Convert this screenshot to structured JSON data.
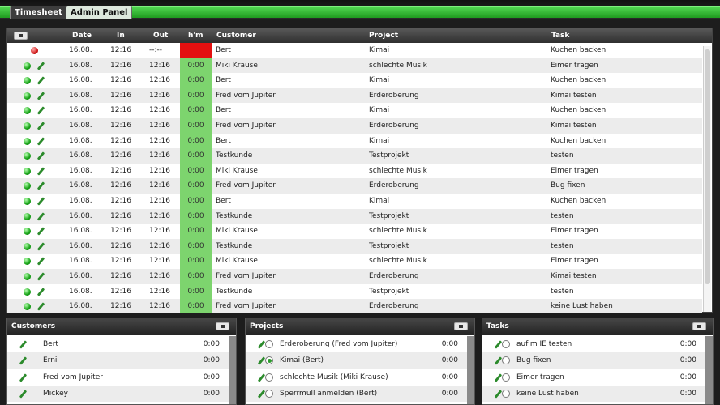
{
  "tabs": [
    {
      "label": "Timesheet",
      "active": true
    },
    {
      "label": "Admin Panel",
      "active": false
    }
  ],
  "timesheet": {
    "columns": {
      "date": "Date",
      "in": "In",
      "out": "Out",
      "hm": "h'm",
      "customer": "Customer",
      "project": "Project",
      "task": "Task"
    },
    "rows": [
      {
        "status": "red",
        "date": "16.08.",
        "in": "12:16",
        "out": "--:--",
        "hm": "",
        "customer": "Bert",
        "project": "Kimai",
        "task": "Kuchen backen"
      },
      {
        "status": "green",
        "date": "16.08.",
        "in": "12:16",
        "out": "12:16",
        "hm": "0:00",
        "customer": "Miki Krause",
        "project": "schlechte Musik",
        "task": "Eimer tragen"
      },
      {
        "status": "green",
        "date": "16.08.",
        "in": "12:16",
        "out": "12:16",
        "hm": "0:00",
        "customer": "Bert",
        "project": "Kimai",
        "task": "Kuchen backen"
      },
      {
        "status": "green",
        "date": "16.08.",
        "in": "12:16",
        "out": "12:16",
        "hm": "0:00",
        "customer": "Fred vom Jupiter",
        "project": "Erderoberung",
        "task": "Kimai testen"
      },
      {
        "status": "green",
        "date": "16.08.",
        "in": "12:16",
        "out": "12:16",
        "hm": "0:00",
        "customer": "Bert",
        "project": "Kimai",
        "task": "Kuchen backen"
      },
      {
        "status": "green",
        "date": "16.08.",
        "in": "12:16",
        "out": "12:16",
        "hm": "0:00",
        "customer": "Fred vom Jupiter",
        "project": "Erderoberung",
        "task": "Kimai testen"
      },
      {
        "status": "green",
        "date": "16.08.",
        "in": "12:16",
        "out": "12:16",
        "hm": "0:00",
        "customer": "Bert",
        "project": "Kimai",
        "task": "Kuchen backen"
      },
      {
        "status": "green",
        "date": "16.08.",
        "in": "12:16",
        "out": "12:16",
        "hm": "0:00",
        "customer": "Testkunde",
        "project": "Testprojekt",
        "task": "testen"
      },
      {
        "status": "green",
        "date": "16.08.",
        "in": "12:16",
        "out": "12:16",
        "hm": "0:00",
        "customer": "Miki Krause",
        "project": "schlechte Musik",
        "task": "Eimer tragen"
      },
      {
        "status": "green",
        "date": "16.08.",
        "in": "12:16",
        "out": "12:16",
        "hm": "0:00",
        "customer": "Fred vom Jupiter",
        "project": "Erderoberung",
        "task": "Bug fixen"
      },
      {
        "status": "green",
        "date": "16.08.",
        "in": "12:16",
        "out": "12:16",
        "hm": "0:00",
        "customer": "Bert",
        "project": "Kimai",
        "task": "Kuchen backen"
      },
      {
        "status": "green",
        "date": "16.08.",
        "in": "12:16",
        "out": "12:16",
        "hm": "0:00",
        "customer": "Testkunde",
        "project": "Testprojekt",
        "task": "testen"
      },
      {
        "status": "green",
        "date": "16.08.",
        "in": "12:16",
        "out": "12:16",
        "hm": "0:00",
        "customer": "Miki Krause",
        "project": "schlechte Musik",
        "task": "Eimer tragen"
      },
      {
        "status": "green",
        "date": "16.08.",
        "in": "12:16",
        "out": "12:16",
        "hm": "0:00",
        "customer": "Testkunde",
        "project": "Testprojekt",
        "task": "testen"
      },
      {
        "status": "green",
        "date": "16.08.",
        "in": "12:16",
        "out": "12:16",
        "hm": "0:00",
        "customer": "Miki Krause",
        "project": "schlechte Musik",
        "task": "Eimer tragen"
      },
      {
        "status": "green",
        "date": "16.08.",
        "in": "12:16",
        "out": "12:16",
        "hm": "0:00",
        "customer": "Fred vom Jupiter",
        "project": "Erderoberung",
        "task": "Kimai testen"
      },
      {
        "status": "green",
        "date": "16.08.",
        "in": "12:16",
        "out": "12:16",
        "hm": "0:00",
        "customer": "Testkunde",
        "project": "Testprojekt",
        "task": "testen"
      },
      {
        "status": "green",
        "date": "16.08.",
        "in": "12:16",
        "out": "12:16",
        "hm": "0:00",
        "customer": "Fred vom Jupiter",
        "project": "Erderoberung",
        "task": "keine Lust haben"
      }
    ]
  },
  "customers": {
    "title": "Customers",
    "items": [
      {
        "name": "Bert",
        "time": "0:00"
      },
      {
        "name": "Erni",
        "time": "0:00"
      },
      {
        "name": "Fred vom Jupiter",
        "time": "0:00"
      },
      {
        "name": "Mickey",
        "time": "0:00"
      }
    ]
  },
  "projects": {
    "title": "Projects",
    "items": [
      {
        "name": "Erderoberung (Fred vom Jupiter)",
        "time": "0:00",
        "selected": false
      },
      {
        "name": "Kimai (Bert)",
        "time": "0:00",
        "selected": true
      },
      {
        "name": "schlechte Musik (Miki Krause)",
        "time": "0:00",
        "selected": false
      },
      {
        "name": "Sperrmüll anmelden (Bert)",
        "time": "0:00",
        "selected": false
      }
    ]
  },
  "tasks": {
    "title": "Tasks",
    "items": [
      {
        "name": "auf'm IE testen",
        "time": "0:00",
        "selected": false
      },
      {
        "name": "Bug fixen",
        "time": "0:00",
        "selected": false
      },
      {
        "name": "Eimer tragen",
        "time": "0:00",
        "selected": false
      },
      {
        "name": "keine Lust haben",
        "time": "0:00",
        "selected": false
      }
    ]
  }
}
